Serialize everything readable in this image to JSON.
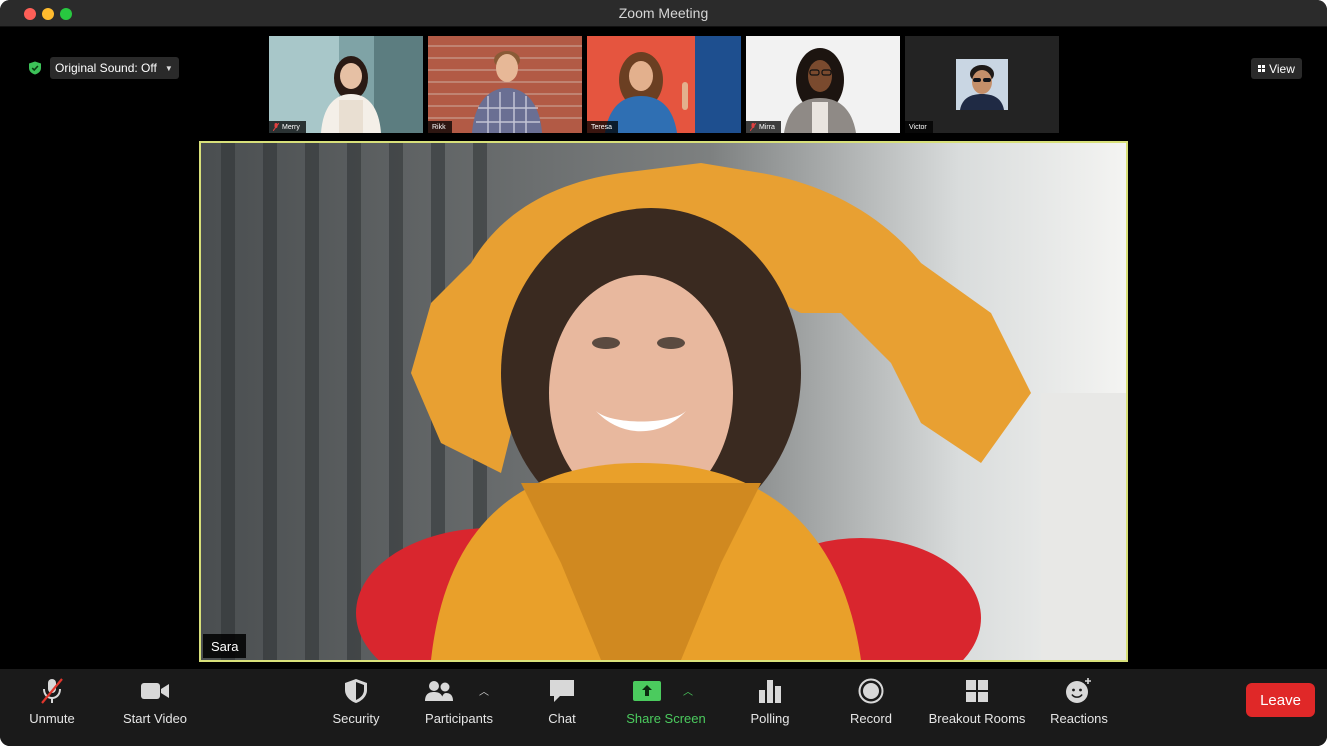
{
  "window": {
    "title": "Zoom Meeting"
  },
  "audio": {
    "original_sound_label": "Original Sound: Off"
  },
  "view": {
    "label": "View"
  },
  "participants_strip": [
    {
      "name": "Merry",
      "muted": true
    },
    {
      "name": "Rikk",
      "muted": false
    },
    {
      "name": "Teresa",
      "muted": false
    },
    {
      "name": "Mirra",
      "muted": true
    },
    {
      "name": "Victor",
      "muted": false
    }
  ],
  "active_speaker": {
    "name": "Sara"
  },
  "toolbar": {
    "unmute": "Unmute",
    "start_video": "Start Video",
    "security": "Security",
    "participants": "Participants",
    "chat": "Chat",
    "share_screen": "Share Screen",
    "polling": "Polling",
    "record": "Record",
    "breakout_rooms": "Breakout Rooms",
    "reactions": "Reactions",
    "leave": "Leave"
  },
  "colors": {
    "active_border": "#d8e07a",
    "share_green": "#4bcb5e",
    "leave_red": "#e02828",
    "toolbar_bg": "#1a1a1a"
  }
}
